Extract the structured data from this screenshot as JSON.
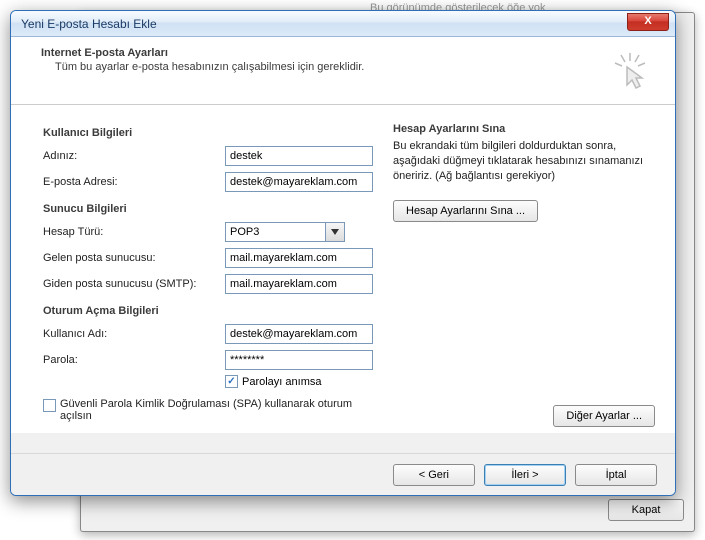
{
  "bg_hint": "Bu görünümde gösterilecek öğe yok",
  "back_window": {
    "close": "Kapat"
  },
  "dialog": {
    "title": "Yeni E-posta Hesabı Ekle",
    "header_title": "Internet E-posta Ayarları",
    "header_sub": "Tüm bu ayarlar e-posta hesabınızın çalışabilmesi için gereklidir."
  },
  "sections": {
    "user": "Kullanıcı Bilgileri",
    "server": "Sunucu Bilgileri",
    "logon": "Oturum Açma Bilgileri"
  },
  "labels": {
    "name": "Adınız:",
    "email": "E-posta Adresi:",
    "acct_type": "Hesap Türü:",
    "incoming": "Gelen posta sunucusu:",
    "outgoing": "Giden posta sunucusu (SMTP):",
    "user": "Kullanıcı Adı:",
    "pass": "Parola:",
    "remember": "Parolayı anımsa",
    "spa": "Güvenli Parola Kimlik Doğrulaması (SPA) kullanarak oturum açılsın"
  },
  "values": {
    "name": "destek",
    "email": "destek@mayareklam.com",
    "acct_type": "POP3",
    "incoming": "mail.mayareklam.com",
    "outgoing": "mail.mayareklam.com",
    "user": "destek@mayareklam.com",
    "pass": "********"
  },
  "right": {
    "head": "Hesap Ayarlarını Sına",
    "text": "Bu ekrandaki tüm bilgileri doldurduktan sonra, aşağıdaki düğmeyi tıklatarak hesabınızı sınamanızı öneririz. (Ağ bağlantısı gerekiyor)",
    "test_btn": "Hesap Ayarlarını Sına ...",
    "more_btn": "Diğer Ayarlar ..."
  },
  "footer": {
    "back": "< Geri",
    "next": "İleri >",
    "cancel": "İptal"
  }
}
